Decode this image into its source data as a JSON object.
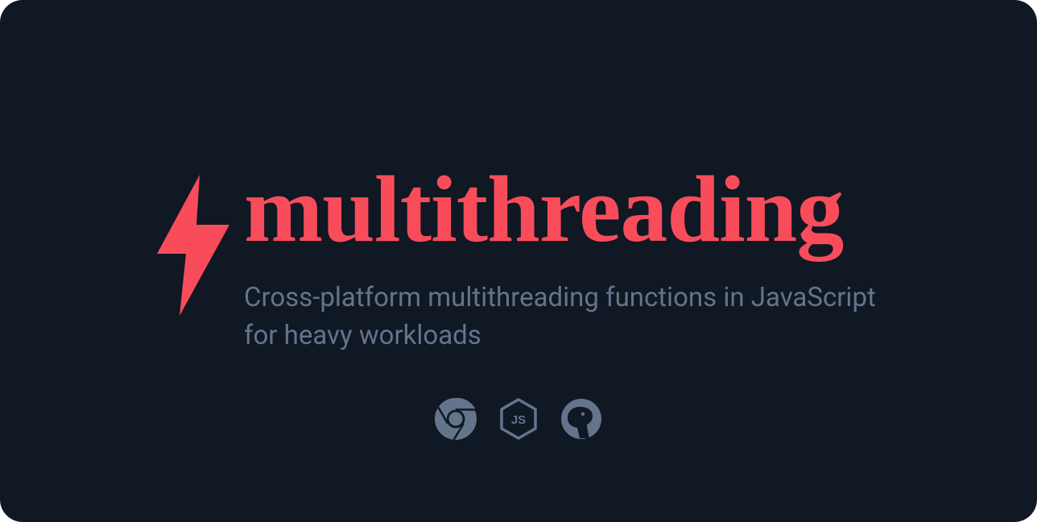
{
  "title": "multithreading",
  "subtitle": "Cross-platform multithreading functions in JavaScript for heavy workloads",
  "colors": {
    "background": "#0f1823",
    "accent": "#f94c5b",
    "muted": "#64748b"
  },
  "platforms": [
    "chrome",
    "nodejs",
    "deno"
  ]
}
